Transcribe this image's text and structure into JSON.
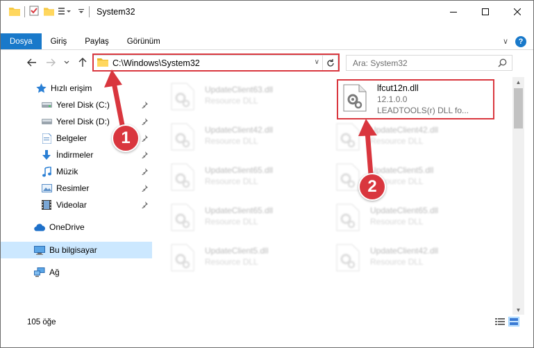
{
  "window": {
    "title": "System32",
    "controls": {
      "minimize": "minimize-icon",
      "maximize": "maximize-icon",
      "close": "close-icon"
    }
  },
  "ribbon": {
    "tabs": [
      "Dosya",
      "Giriş",
      "Paylaş",
      "Görünüm"
    ],
    "help": "?"
  },
  "address": {
    "path": "C:\\Windows\\System32",
    "search_placeholder": "Ara: System32"
  },
  "sidebar": {
    "items": [
      {
        "label": "Hızlı erişim",
        "icon": "star-icon"
      },
      {
        "label": "Yerel Disk (C:)",
        "icon": "drive-icon",
        "pinned": true
      },
      {
        "label": "Yerel Disk (D:)",
        "icon": "drive-icon",
        "pinned": true
      },
      {
        "label": "Belgeler",
        "icon": "documents-icon",
        "pinned": true
      },
      {
        "label": "İndirmeler",
        "icon": "download-icon",
        "pinned": true
      },
      {
        "label": "Müzik",
        "icon": "music-icon",
        "pinned": true
      },
      {
        "label": "Resimler",
        "icon": "pictures-icon",
        "pinned": true
      },
      {
        "label": "Videolar",
        "icon": "videos-icon",
        "pinned": true
      },
      {
        "label": "OneDrive",
        "icon": "cloud-icon"
      },
      {
        "label": "Bu bilgisayar",
        "icon": "computer-icon",
        "selected": true
      },
      {
        "label": "Ağ",
        "icon": "network-icon"
      }
    ]
  },
  "files": {
    "highlighted": {
      "name": "lfcut12n.dll",
      "version": "12.1.0.0",
      "description": "LEADTOOLS(r) DLL fo..."
    },
    "left_column": [
      {
        "name": "UpdateClient63.dll",
        "type": "Resource DLL"
      },
      {
        "name": "UpdateClient42.dll",
        "type": "Resource DLL"
      },
      {
        "name": "UpdateClient65.dll",
        "type": "Resource DLL"
      },
      {
        "name": "UpdateClient65.dll",
        "type": "Resource DLL"
      },
      {
        "name": "UpdateClient5.dll",
        "type": "Resource DLL"
      }
    ],
    "right_column": [
      {
        "name": "UpdateClient42.dll",
        "type": "Resource DLL"
      },
      {
        "name": "UpdateClient5.dll",
        "type": "Resource DLL"
      },
      {
        "name": "UpdateClient65.dll",
        "type": "Resource DLL"
      },
      {
        "name": "UpdateClient42.dll",
        "type": "Resource DLL"
      }
    ]
  },
  "status": {
    "item_count": "105 öğe"
  },
  "annotations": {
    "step1": "1",
    "step2": "2",
    "color": "#d9363e"
  }
}
